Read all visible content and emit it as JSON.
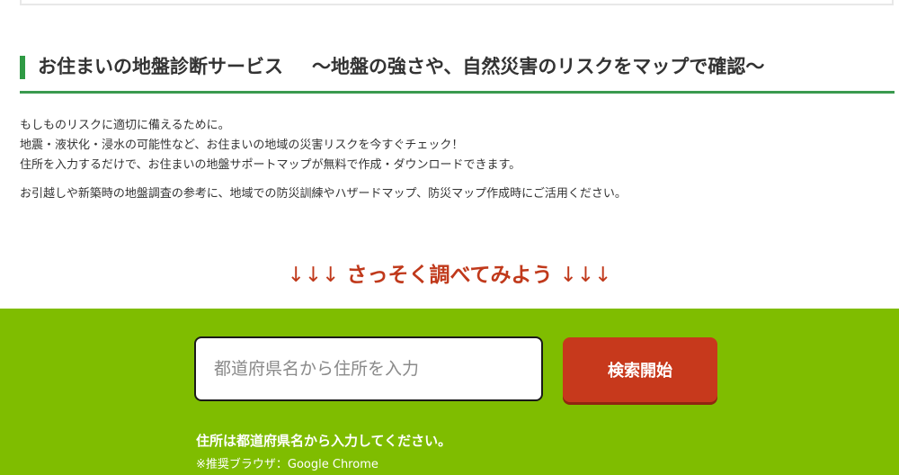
{
  "heading": {
    "title": "お住まいの地盤診断サービス",
    "subtitle": "～地盤の強さや、自然災害のリスクをマップで確認～"
  },
  "intro": {
    "line1": "もしものリスクに適切に備えるために。",
    "line2": "地震・液状化・浸水の可能性など、お住まいの地域の災害リスクを今すぐチェック！",
    "line3": "住所を入力するだけで、お住まいの地盤サポートマップが無料で作成・ダウンロードできます。",
    "line4": "お引越しや新築時の地盤調査の参考に、地域での防災訓練やハザードマップ、防災マップ作成時にご活用ください。"
  },
  "cta": {
    "arrows_left": "↓↓↓",
    "text": "さっそく調べてみよう",
    "arrows_right": "↓↓↓"
  },
  "search": {
    "placeholder": "都道府県名から住所を入力",
    "value": "",
    "button_label": "検索開始",
    "note": "住所は都道府県名から入力してください。",
    "browser_note": "※推奨ブラウザ：Google Chrome"
  },
  "colors": {
    "accent_green": "#2f9a44",
    "section_green": "#7fbd00",
    "cta_red": "#c0391b",
    "button_red": "#c7391c"
  }
}
